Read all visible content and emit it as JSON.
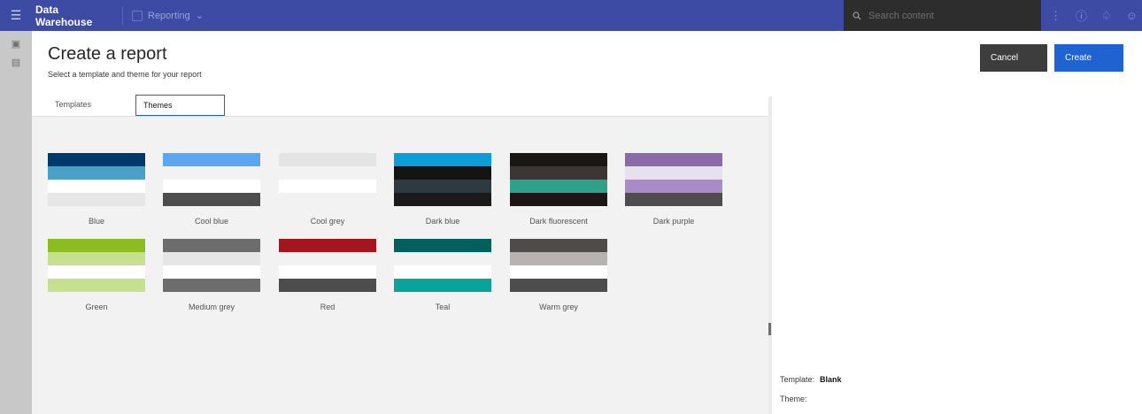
{
  "topbar": {
    "menu_icon": "hamburger-icon",
    "title": "Data Warehouse",
    "reporting_label": "Reporting",
    "search_placeholder": "Search content",
    "icons": [
      "more-icon",
      "help-icon",
      "notification-icon",
      "user-icon"
    ],
    "colors": {
      "bar": "#3d4ba5",
      "search_bg": "#2d2d2d"
    }
  },
  "rail": {
    "icons": [
      "panel-toggle-icon",
      "clipboard-icon"
    ]
  },
  "page": {
    "title": "Create a report",
    "subtitle": "Select a template and theme for your report"
  },
  "buttons": {
    "cancel": "Cancel",
    "create": "Create"
  },
  "tabs": [
    {
      "label": "Templates",
      "selected": false
    },
    {
      "label": "Themes",
      "selected": true
    }
  ],
  "themes": [
    {
      "name": "Blue",
      "colors": [
        "#003a6d",
        "#4aa0c9",
        "#ffffff",
        "#e6e6e6"
      ]
    },
    {
      "name": "Cool blue",
      "colors": [
        "#5aa7f0",
        "#f2f2f2",
        "#ffffff",
        "#4d4d4d"
      ]
    },
    {
      "name": "Cool grey",
      "colors": [
        "#e4e4e4",
        "#f2f2f2",
        "#ffffff",
        "#f2f2f2"
      ]
    },
    {
      "name": "Dark blue",
      "colors": [
        "#0d9ed9",
        "#141414",
        "#2d3a40",
        "#1a1a1a"
      ]
    },
    {
      "name": "Dark fluorescent",
      "colors": [
        "#1a1614",
        "#3b3634",
        "#2fa08a",
        "#1c1714"
      ]
    },
    {
      "name": "Dark purple",
      "colors": [
        "#8a6aa8",
        "#e7e1ef",
        "#a98bc8",
        "#4d4d4d"
      ]
    },
    {
      "name": "Green",
      "colors": [
        "#8cbb22",
        "#c5e08f",
        "#ffffff",
        "#c5e08f"
      ]
    },
    {
      "name": "Medium grey",
      "colors": [
        "#6d6d6d",
        "#e6e6e6",
        "#ffffff",
        "#6d6d6d"
      ]
    },
    {
      "name": "Red",
      "colors": [
        "#a4151e",
        "#f2f2f2",
        "#ffffff",
        "#4d4d4d"
      ]
    },
    {
      "name": "Teal",
      "colors": [
        "#00605c",
        "#f2f2f2",
        "#ffffff",
        "#0aa39a"
      ]
    },
    {
      "name": "Warm grey",
      "colors": [
        "#4f4b49",
        "#b6b3b1",
        "#ffffff",
        "#4d4d4d"
      ]
    }
  ],
  "summary": {
    "template_label": "Template:",
    "template_value": "Blank",
    "theme_label": "Theme:",
    "theme_value": ""
  }
}
